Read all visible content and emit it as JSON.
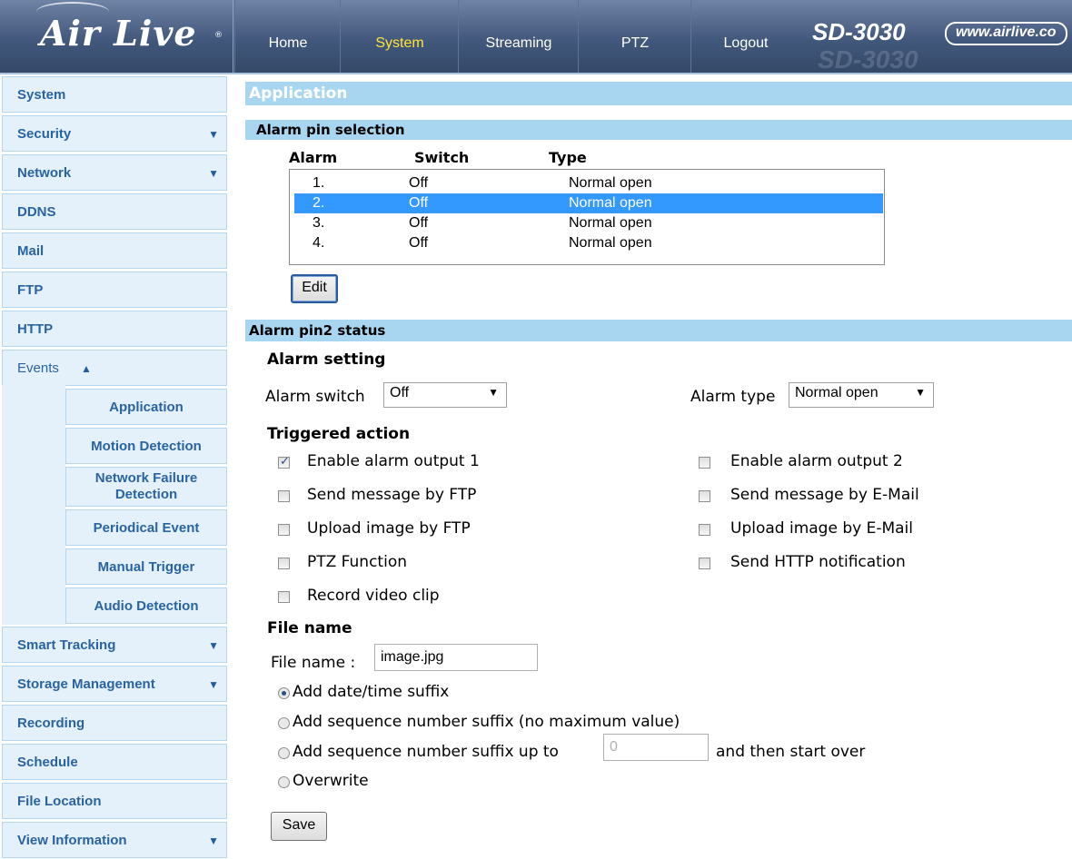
{
  "header": {
    "logo_text": "Air Live",
    "logo_mark": "®",
    "tabs": [
      {
        "label": "Home"
      },
      {
        "label": "System"
      },
      {
        "label": "Streaming"
      },
      {
        "label": "PTZ"
      },
      {
        "label": "Logout"
      }
    ],
    "active_tab": "System",
    "model": "SD-3030",
    "model_ghost": "SD-3030",
    "website": "www.airlive.co"
  },
  "sidebar": {
    "items": [
      {
        "label": "System",
        "arrow": ""
      },
      {
        "label": "Security",
        "arrow": "▼"
      },
      {
        "label": "Network",
        "arrow": "▼"
      },
      {
        "label": "DDNS",
        "arrow": ""
      },
      {
        "label": "Mail",
        "arrow": ""
      },
      {
        "label": "FTP",
        "arrow": ""
      },
      {
        "label": "HTTP",
        "arrow": ""
      },
      {
        "label": "Events",
        "arrow": "▲"
      },
      {
        "label": "Smart Tracking",
        "arrow": "▼"
      },
      {
        "label": "Storage Management",
        "arrow": "▼"
      },
      {
        "label": "Recording",
        "arrow": ""
      },
      {
        "label": "Schedule",
        "arrow": ""
      },
      {
        "label": "File Location",
        "arrow": ""
      },
      {
        "label": "View Information",
        "arrow": "▼"
      }
    ],
    "events_sub": [
      {
        "label": "Application"
      },
      {
        "label": "Motion Detection"
      },
      {
        "label": "Network Failure Detection"
      },
      {
        "label": "Periodical Event"
      },
      {
        "label": "Manual Trigger"
      },
      {
        "label": "Audio Detection"
      }
    ]
  },
  "main": {
    "page_title": "Application",
    "alarm_pin_selection": {
      "heading": "Alarm pin selection",
      "columns": [
        "Alarm",
        "Switch",
        "Type"
      ],
      "rows": [
        {
          "alarm": "1.",
          "switch": "Off",
          "type": "Normal open"
        },
        {
          "alarm": "2.",
          "switch": "Off",
          "type": "Normal open"
        },
        {
          "alarm": "3.",
          "switch": "Off",
          "type": "Normal open"
        },
        {
          "alarm": "4.",
          "switch": "Off",
          "type": "Normal open"
        }
      ],
      "selected_row": 2,
      "edit_label": "Edit"
    },
    "status": {
      "heading": "Alarm pin2 status",
      "alarm_setting_heading": "Alarm setting",
      "alarm_switch_label": "Alarm switch",
      "alarm_switch_value": "Off",
      "alarm_type_label": "Alarm type",
      "alarm_type_value": "Normal open",
      "triggered_action_heading": "Triggered action",
      "actions_left": [
        {
          "label": "Enable alarm output 1",
          "checked": true
        },
        {
          "label": "Send message by FTP",
          "checked": false
        },
        {
          "label": "Upload image by FTP",
          "checked": false
        },
        {
          "label": "PTZ Function",
          "checked": false
        },
        {
          "label": "Record video clip",
          "checked": false
        }
      ],
      "actions_right": [
        {
          "label": "Enable alarm output 2",
          "checked": false
        },
        {
          "label": "Send message by E-Mail",
          "checked": false
        },
        {
          "label": "Upload image by E-Mail",
          "checked": false
        },
        {
          "label": "Send HTTP notification",
          "checked": false
        }
      ],
      "file_name_heading": "File name",
      "file_name_label": "File name :",
      "file_name_value": "image.jpg",
      "suffix_options": [
        {
          "label": "Add date/time suffix",
          "selected": true
        },
        {
          "label": "Add sequence number suffix (no maximum value)",
          "selected": false
        },
        {
          "label": "Add sequence number suffix up to",
          "selected": false
        },
        {
          "label": "Overwrite",
          "selected": false
        }
      ],
      "seq_max_placeholder": "0",
      "seq_after_label": "and then start over",
      "save_label": "Save"
    }
  }
}
